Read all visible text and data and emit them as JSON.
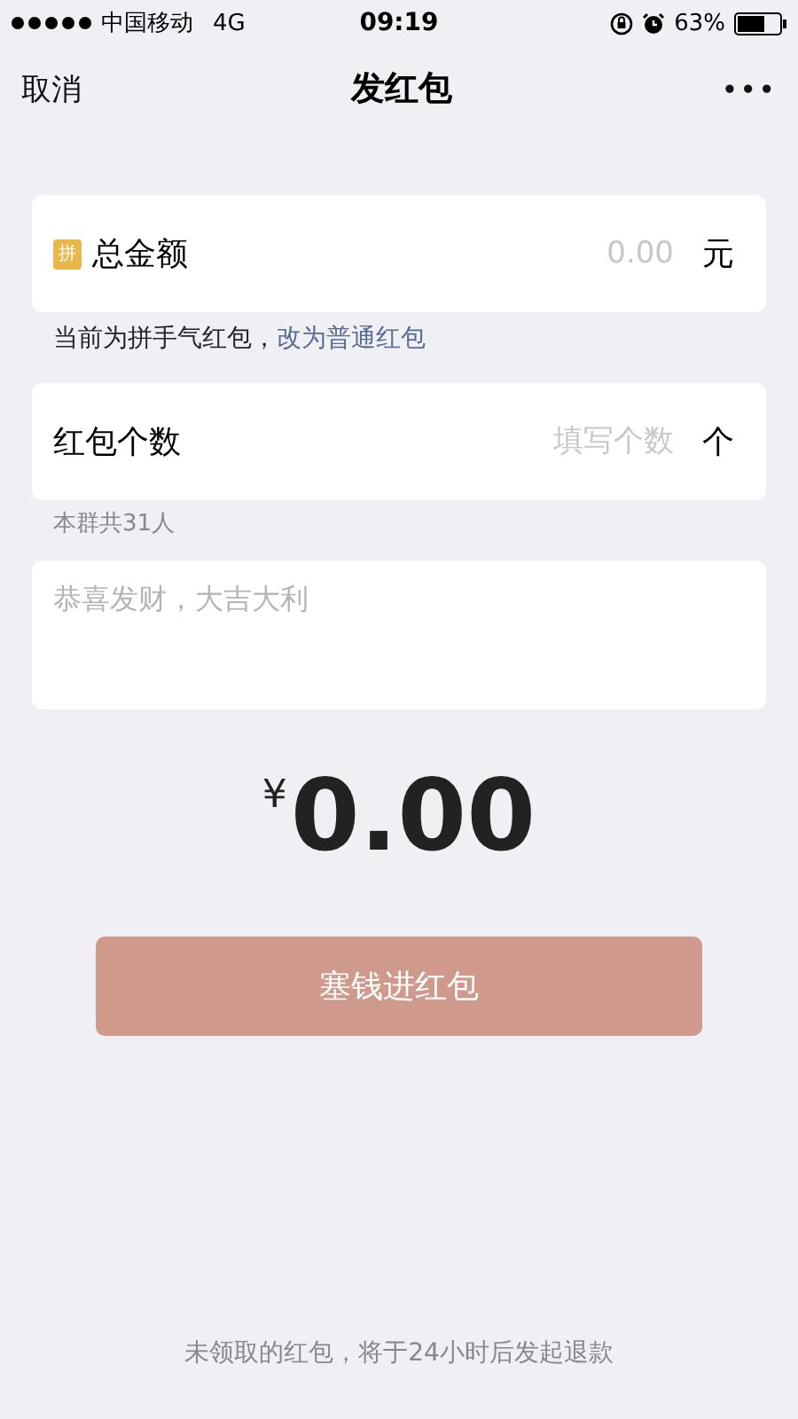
{
  "status_bar": {
    "carrier": "中国移动",
    "network": "4G",
    "time": "09:19",
    "battery": "63%"
  },
  "nav": {
    "cancel": "取消",
    "title": "发红包",
    "more": "•••"
  },
  "amount": {
    "badge": "拼",
    "label": "总金额",
    "placeholder": "0.00",
    "unit": "元"
  },
  "type_note": {
    "text": "当前为拼手气红包，",
    "link": "改为普通红包"
  },
  "count": {
    "label": "红包个数",
    "placeholder": "填写个数",
    "unit": "个"
  },
  "group_note": "本群共31人",
  "message": {
    "placeholder": "恭喜发财，大吉大利"
  },
  "total": {
    "currency": "¥",
    "value": "0.00"
  },
  "submit": {
    "label": "塞钱进红包",
    "disabled": true
  },
  "footer": "未领取的红包，将于24小时后发起退款"
}
